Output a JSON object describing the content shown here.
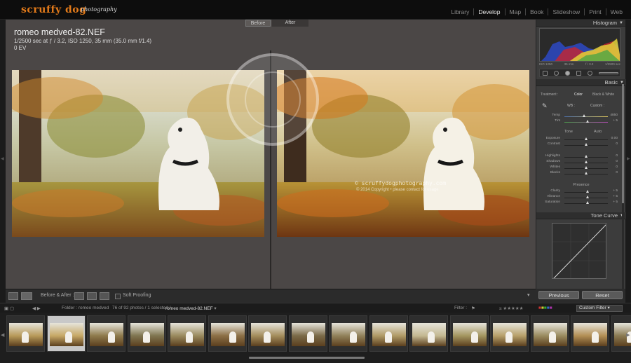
{
  "brand": {
    "name": "scruffy dog",
    "sub": "photography"
  },
  "modules": [
    "Library",
    "Develop",
    "Map",
    "Book",
    "Slideshow",
    "Print",
    "Web"
  ],
  "active_module": "Develop",
  "view": {
    "before_label": "Before",
    "after_label": "After",
    "filename": "romeo medved-82.NEF",
    "exposure_info": "1/2500 sec at ƒ / 3.2, ISO 1250, 35 mm (35.0 mm f/1.4)",
    "ev": "0 EV",
    "watermark_url": "© scruffydogphotography.com",
    "watermark_sub": "© 2014 Copyright  •  please contact for usage",
    "accent_color": "#e27a1a"
  },
  "toolbar": {
    "before_after_label": "Before & After :",
    "soft_proofing_label": "Soft Proofing"
  },
  "right_panel": {
    "histogram_label": "Histogram",
    "hist_meta": [
      "ISO 1250",
      "35 mm",
      "f / 3.2",
      "1/2500 sec"
    ],
    "basic_label": "Basic",
    "treatment_label": "Treatment :",
    "treatment_color": "Color",
    "treatment_bw": "Black & White",
    "wb_label": "WB :",
    "wb_value": "Custom :",
    "temp_label": "Temp",
    "temp_value": "4850",
    "tint_label": "Tint",
    "tint_value": "+ 5",
    "tone_label": "Tone",
    "tone_auto": "Auto",
    "tone_sliders": [
      {
        "label": "Exposure",
        "value": "0.00",
        "pos": 0.5
      },
      {
        "label": "Contrast",
        "value": "0",
        "pos": 0.5
      }
    ],
    "tone_sliders2": [
      {
        "label": "Highlights",
        "value": "0",
        "pos": 0.5
      },
      {
        "label": "Shadows",
        "value": "0",
        "pos": 0.5
      },
      {
        "label": "Whites",
        "value": "0",
        "pos": 0.5
      },
      {
        "label": "Blacks",
        "value": "0",
        "pos": 0.5
      }
    ],
    "presence_label": "Presence",
    "presence_sliders": [
      {
        "label": "Clarity",
        "value": "+ 5",
        "pos": 0.54
      },
      {
        "label": "Vibrance",
        "value": "+ 5",
        "pos": 0.54
      },
      {
        "label": "Saturation",
        "value": "+ 5",
        "pos": 0.54
      }
    ],
    "tone_curve_label": "Tone Curve",
    "previous_label": "Previous",
    "reset_label": "Reset"
  },
  "filmstrip_bar": {
    "folder_text": "Folder : romeo medved",
    "count_text": "76 of 92 photos / 1 selected /",
    "selected_file": "romeo medved-82.NEF",
    "filter_label": "Filter :",
    "filter_value": "Custom Filter"
  },
  "filmstrip": {
    "thumb_count": 16,
    "selected_index": 1
  }
}
